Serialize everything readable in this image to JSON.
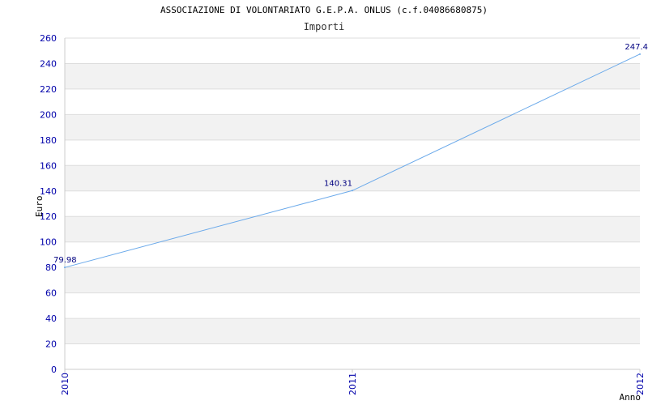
{
  "title": "ASSOCIAZIONE DI VOLONTARIATO G.E.P.A. ONLUS (c.f.04086680875)",
  "chart_data": {
    "type": "line",
    "title": "Importi",
    "xlabel": "Anno",
    "ylabel": "Euro",
    "categories": [
      "2010",
      "2011",
      "2012"
    ],
    "series": [
      {
        "values": [
          79.98,
          140.31,
          247.4
        ]
      }
    ],
    "data_labels": [
      "79.98",
      "140.31",
      "247.4"
    ],
    "ylim": [
      0,
      260
    ],
    "yticks": [
      0,
      20,
      40,
      60,
      80,
      100,
      120,
      140,
      160,
      180,
      200,
      220,
      240,
      260
    ],
    "grid": true,
    "legend": "none",
    "colors": {
      "line": "#6aa9ea",
      "tick_text": "#0000aa",
      "data_label": "#000080",
      "band_alt": "#f2f2f2",
      "grid": "#dddddd"
    }
  }
}
